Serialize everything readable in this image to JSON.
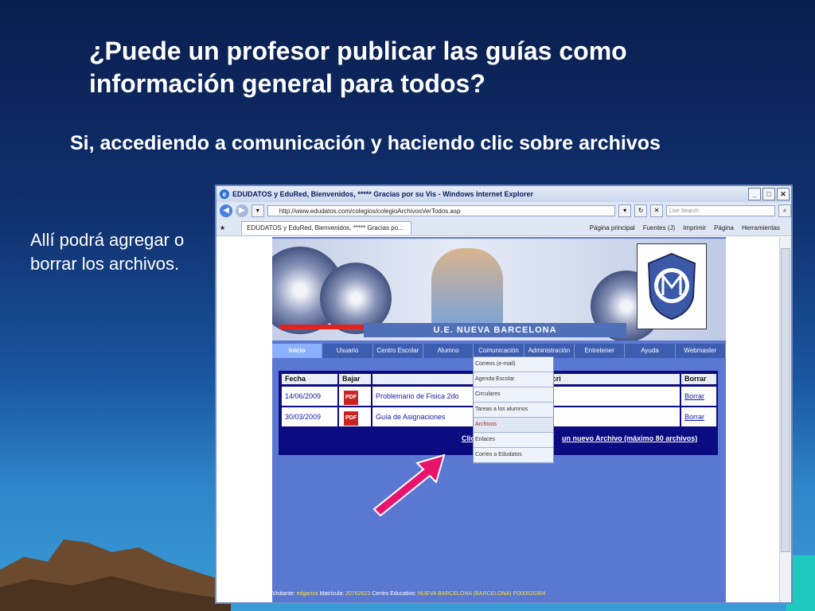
{
  "slide": {
    "title": "¿Puede un profesor publicar las guías como información general para todos?",
    "subtitle": "Si, accediendo a comunicación y haciendo clic sobre archivos",
    "side_text": "Allí podrá agregar o borrar los archivos."
  },
  "browser": {
    "window_title": "EDUDATOS y EduRed, Bienvenidos, ***** Gracias por su Vis - Windows Internet Explorer",
    "url": "http://www.edudatos.com/colegios/colegioArchivosVerTodos.asp",
    "search_placeholder": "Live Search",
    "tab_label": "EDUDATOS y EduRed, Bienvenidos, ***** Gracias po...",
    "toolbar": [
      "Página principal",
      "Fuentes (J)",
      "Imprimir",
      "Página",
      "Herramientas"
    ]
  },
  "site": {
    "school_name": "U.E. NUEVA BARCELONA",
    "menu": [
      "Inicio",
      "Usuario",
      "Centro Escolar",
      "Alumno",
      "Comunicación",
      "Administración",
      "Entretener",
      "Ayuda",
      "Webmaster"
    ],
    "table": {
      "headers": [
        "Fecha",
        "Bajar",
        "Descri",
        "Borrar"
      ],
      "rows": [
        {
          "fecha": "14/06/2009",
          "descripcion": "Problemario de Fisica 2do",
          "borrar": "Borrar"
        },
        {
          "fecha": "30/03/2009",
          "descripcion": "Guía de Asignaciones",
          "borrar": "Borrar"
        }
      ],
      "add_link_start": "Clic",
      "add_link_end": "un nuevo Archivo (máximo 80 archivos)"
    },
    "dropdown": [
      "Correos (e-mail)",
      "Agenda Escolar",
      "Circulares",
      "Tareas a los alumnos",
      "Archivos",
      "Enlaces",
      "Correo a Edudatos"
    ],
    "status": {
      "visitante_label": "Visitante:",
      "visitante": "edgariza",
      "matricula_label": "Matrícula:",
      "matricula": "20762623",
      "centro_label": "Centro Educativo:",
      "centro": "NUEVA BARCELONA (BARCELONA) PD00520304"
    }
  },
  "colors": {
    "highlight_arrow": "#e8136b",
    "menu_bg": "#3d5db0",
    "table_bg": "#0b0b82"
  }
}
